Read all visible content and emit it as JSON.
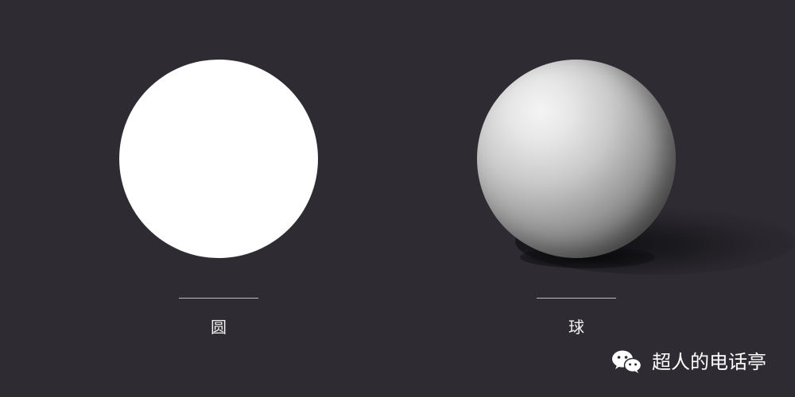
{
  "scene": {
    "background_color": "#2e2c32",
    "items": [
      {
        "label": "圆",
        "shape": "flat circle",
        "fill_color": "#ffffff"
      },
      {
        "label": "球",
        "shape": "shaded sphere",
        "highlight_color": "#f4f4f4",
        "shadow_color": "#3f3f3f"
      }
    ]
  },
  "watermark": {
    "text": "超人的电话亭",
    "icon": "wechat-icon"
  }
}
